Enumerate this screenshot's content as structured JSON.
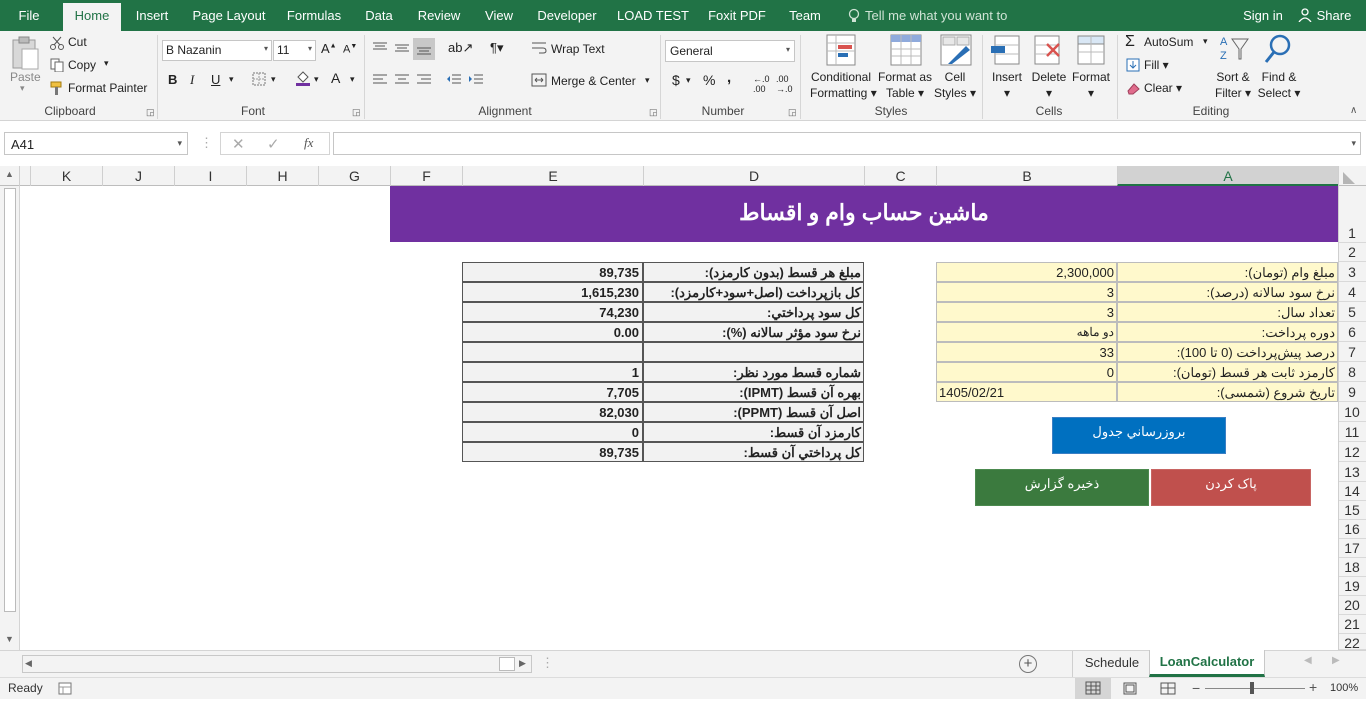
{
  "ribbon_tabs": [
    "File",
    "Home",
    "Insert",
    "Page Layout",
    "Formulas",
    "Data",
    "Review",
    "View",
    "Developer",
    "LOAD TEST",
    "Foxit PDF",
    "Team"
  ],
  "tell_me": "Tell me what you want to do...",
  "sign_in": "Sign in",
  "share": "Share",
  "clipboard": {
    "paste": "Paste",
    "cut": "Cut",
    "copy": "Copy",
    "format_painter": "Format Painter",
    "label": "Clipboard"
  },
  "font": {
    "name": "B Nazanin",
    "size": "11",
    "bold": "B",
    "italic": "I",
    "underline": "U",
    "label": "Font"
  },
  "alignment": {
    "wrap_text": "Wrap Text",
    "merge_center": "Merge & Center",
    "label": "Alignment"
  },
  "number": {
    "format": "General",
    "currency": "$",
    "percent": "%",
    "comma": ",",
    "label": "Number"
  },
  "styles": {
    "conditional_1": "Conditional",
    "conditional_2": "Formatting",
    "format_table_1": "Format as",
    "format_table_2": "Table",
    "cell_styles_1": "Cell",
    "cell_styles_2": "Styles",
    "label": "Styles"
  },
  "cells": {
    "insert": "Insert",
    "delete": "Delete",
    "format": "Format",
    "label": "Cells"
  },
  "editing": {
    "autosum": "AutoSum",
    "fill": "Fill",
    "clear": "Clear",
    "sort_1": "Sort &",
    "sort_2": "Filter",
    "find_1": "Find &",
    "find_2": "Select",
    "label": "Editing"
  },
  "formula_bar": {
    "name_box": "A41",
    "fx": "fx",
    "content": ""
  },
  "columns": [
    "K",
    "J",
    "I",
    "H",
    "G",
    "F",
    "E",
    "D",
    "C",
    "B",
    "A"
  ],
  "rows": [
    "1",
    "2",
    "3",
    "4",
    "5",
    "6",
    "7",
    "8",
    "9",
    "10",
    "11",
    "12",
    "13",
    "14",
    "15",
    "16",
    "17",
    "18",
    "19",
    "20",
    "21",
    "22"
  ],
  "sheet": {
    "title": "ماشین حساب وام و اقساط",
    "inputs": [
      {
        "label": "مبلغ وام (تومان):",
        "value": "2,300,000"
      },
      {
        "label": "نرخ سود سالانه (درصد):",
        "value": "3"
      },
      {
        "label": "تعداد سال:",
        "value": "3"
      },
      {
        "label": "دوره پرداخت:",
        "value": "دو ماهه"
      },
      {
        "label": "درصد پیش‌پرداخت (0 تا 100):",
        "value": "33"
      },
      {
        "label": "کارمزد ثابت هر قسط (تومان):",
        "value": "0"
      },
      {
        "label": "تاریخ شروع (شمسی):",
        "value": "1405/02/21"
      }
    ],
    "results": [
      {
        "label": "مبلغ هر قسط (بدون کارمزد):",
        "value": "89,735"
      },
      {
        "label": "کل بازپرداخت (اصل+سود+کارمزد):",
        "value": "1,615,230"
      },
      {
        "label": "کل سود پرداختي:",
        "value": "74,230"
      },
      {
        "label": "نرخ سود مؤثر سالانه (%):",
        "value": "0.00"
      },
      {
        "label": "",
        "value": ""
      },
      {
        "label": "شماره قسط مورد نظر:",
        "value": "1"
      },
      {
        "label": "بهره آن قسط (IPMT):",
        "value": "7,705"
      },
      {
        "label": "اصل آن قسط (PPMT):",
        "value": "82,030"
      },
      {
        "label": "کارمزد آن قسط:",
        "value": "0"
      },
      {
        "label": "کل پرداختي آن قسط:",
        "value": "89,735"
      }
    ],
    "btn_refresh": "بروزرساني جدول",
    "btn_save": "ذخيره گزارش",
    "btn_clear": "پاک کردن"
  },
  "sheet_tabs": [
    "Schedule",
    "LoanCalculator"
  ],
  "status": {
    "ready": "Ready",
    "zoom": "100%"
  },
  "colors": {
    "excel_green": "#217346",
    "banner": "#7030a0",
    "input_fill": "#fff9cc",
    "refresh": "#0070c0",
    "save": "#3b7a3e",
    "clear": "#c0504d"
  }
}
